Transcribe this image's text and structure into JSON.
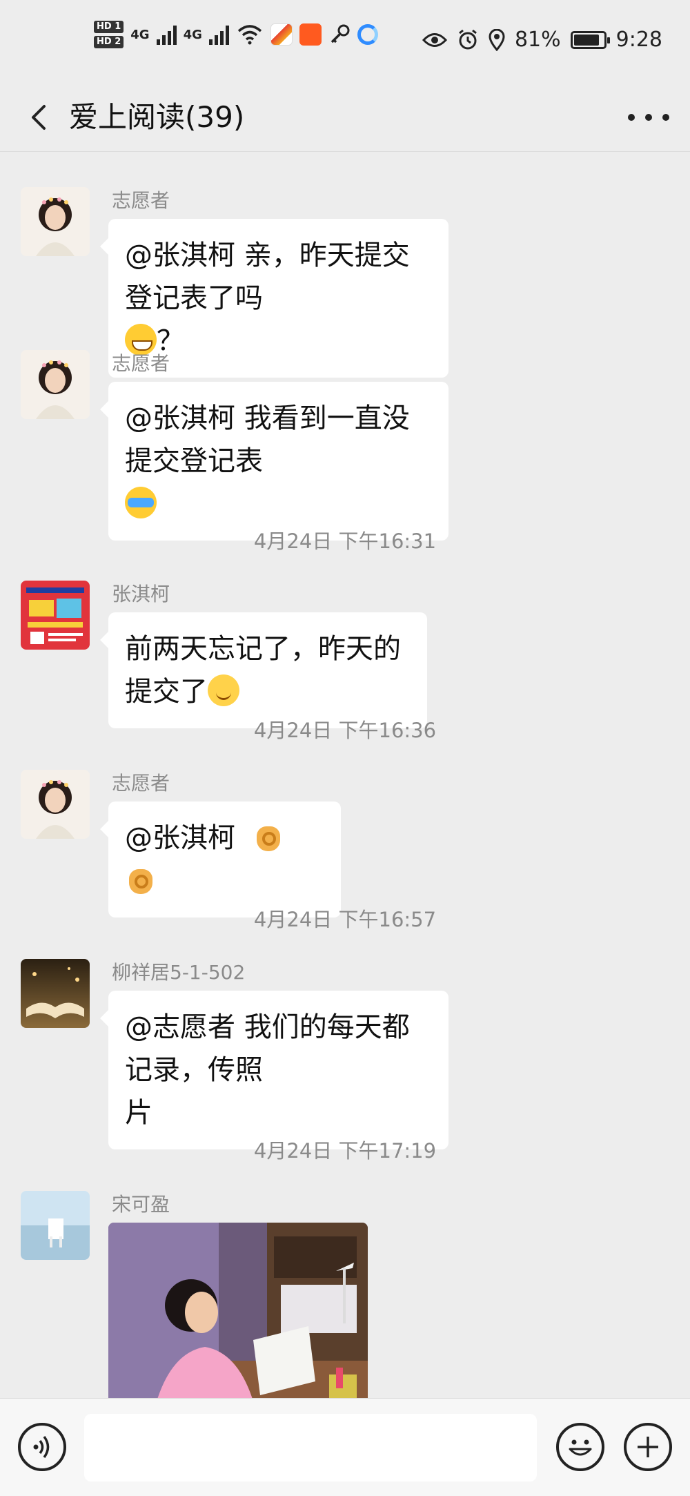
{
  "status_bar": {
    "hd1": "HD 1",
    "hd2": "HD 2",
    "net1": "4G",
    "net2": "4G",
    "battery": "81%",
    "battery_level": 0.81,
    "time": "9:28",
    "icons": [
      "wifi-icon",
      "app-icon",
      "kuaishou-icon",
      "key-icon",
      "browser-icon",
      "eye-icon",
      "alarm-icon",
      "location-icon",
      "battery-icon"
    ]
  },
  "header": {
    "title": "爱上阅读(39)"
  },
  "messages": [
    {
      "sender": "志愿者",
      "text": "@张淇柯  亲，昨天提交登记表了吗",
      "text_line2": "？",
      "emoji": "grin-emoji"
    },
    {
      "sender": "志愿者",
      "text": "@张淇柯  我看到一直没提交登记表",
      "emoji": "laugh-cry-emoji"
    },
    {
      "timestamp": "4月24日 下午16:31"
    },
    {
      "sender": "张淇柯",
      "text": "前两天忘记了，昨天的提交了",
      "emoji": "smile-emoji"
    },
    {
      "timestamp": "4月24日 下午16:36"
    },
    {
      "sender": "志愿者",
      "text": "@张淇柯",
      "emoji": "ok-hand-emoji"
    },
    {
      "timestamp": "4月24日 下午16:57"
    },
    {
      "sender": "柳祥居5-1-502",
      "text": "@志愿者  我们的每天都记录，传照",
      "text_line2": "片"
    },
    {
      "timestamp": "4月24日 下午17:19"
    },
    {
      "sender": "宋可盈",
      "image": "photo-girl-reading"
    }
  ],
  "input": {
    "placeholder": ""
  },
  "colors": {
    "background": "#ededed",
    "bubble": "#ffffff",
    "meta_text": "#8a8a8a"
  }
}
